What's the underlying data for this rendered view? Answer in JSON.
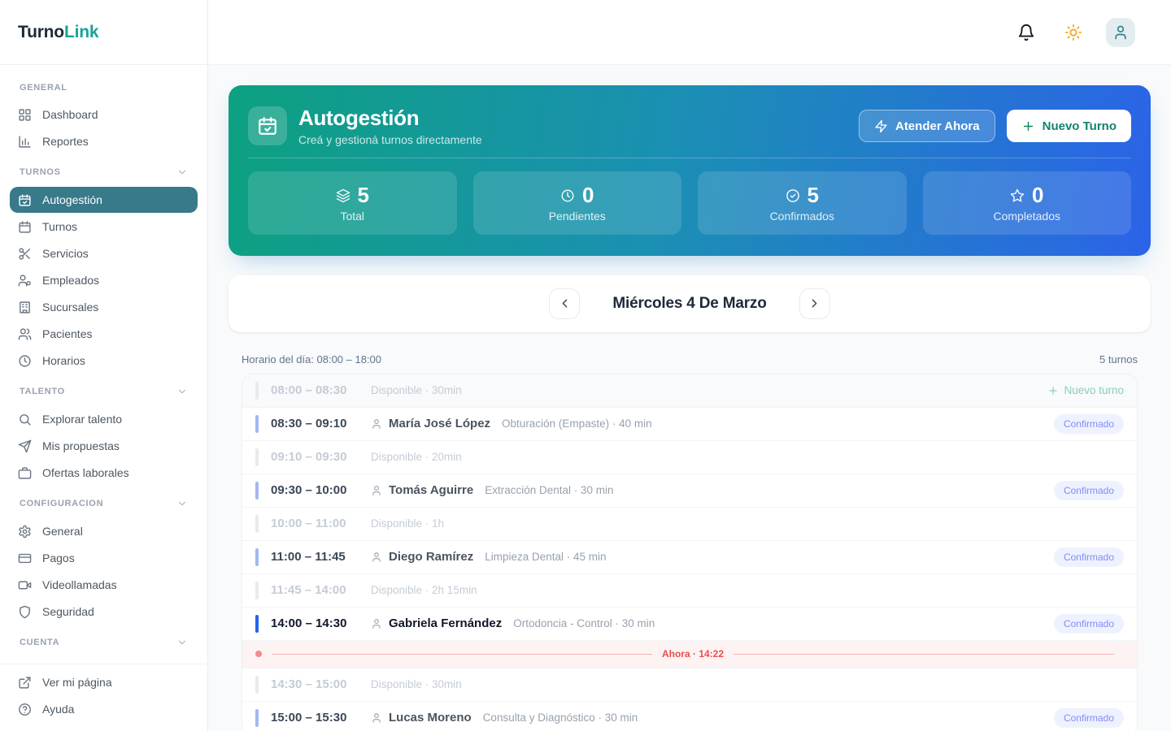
{
  "app": {
    "logo_primary": "Turno",
    "logo_accent": "Link"
  },
  "colors": {
    "accent_teal": "#38798a",
    "logo_teal": "#18a29c",
    "banner_gradient_from": "#0da180",
    "banner_gradient_to": "#2b63e8",
    "badge_bg": "#eef2ff",
    "badge_text": "#818cf8",
    "current_bar": "#2563eb",
    "booked_bar": "#a3b8f0",
    "now_red": "#e94e4e",
    "sun_amber": "#f5a524"
  },
  "topbar": {
    "icons": [
      "bell",
      "sun",
      "user"
    ]
  },
  "sidebar": {
    "sections": [
      {
        "label": "GENERAL",
        "collapsible": false,
        "items": [
          {
            "icon": "dashboard",
            "label": "Dashboard",
            "active": false
          },
          {
            "icon": "bar-chart",
            "label": "Reportes",
            "active": false
          }
        ]
      },
      {
        "label": "TURNOS",
        "collapsible": true,
        "items": [
          {
            "icon": "calendar-check",
            "label": "Autogestión",
            "active": true
          },
          {
            "icon": "calendar",
            "label": "Turnos",
            "active": false
          },
          {
            "icon": "scissors",
            "label": "Servicios",
            "active": false
          },
          {
            "icon": "user-cog",
            "label": "Empleados",
            "active": false
          },
          {
            "icon": "building",
            "label": "Sucursales",
            "active": false
          },
          {
            "icon": "users",
            "label": "Pacientes",
            "active": false
          },
          {
            "icon": "clock",
            "label": "Horarios",
            "active": false
          }
        ]
      },
      {
        "label": "TALENTO",
        "collapsible": true,
        "items": [
          {
            "icon": "search",
            "label": "Explorar talento",
            "active": false
          },
          {
            "icon": "send",
            "label": "Mis propuestas",
            "active": false
          },
          {
            "icon": "briefcase",
            "label": "Ofertas laborales",
            "active": false
          }
        ]
      },
      {
        "label": "CONFIGURACION",
        "collapsible": true,
        "items": [
          {
            "icon": "gear",
            "label": "General",
            "active": false
          },
          {
            "icon": "credit-card",
            "label": "Pagos",
            "active": false
          },
          {
            "icon": "video",
            "label": "Videollamadas",
            "active": false
          },
          {
            "icon": "shield",
            "label": "Seguridad",
            "active": false
          }
        ]
      },
      {
        "label": "CUENTA",
        "collapsible": true,
        "items": []
      }
    ],
    "footer_items": [
      {
        "icon": "external-link",
        "label": "Ver mi página"
      },
      {
        "icon": "help-circle",
        "label": "Ayuda"
      }
    ]
  },
  "banner": {
    "title": "Autogestión",
    "subtitle": "Creá y gestioná turnos directamente",
    "buttons": [
      {
        "icon": "bolt",
        "label": "Atender Ahora"
      },
      {
        "icon": "plus",
        "label": "Nuevo Turno"
      }
    ],
    "stats": [
      {
        "icon": "layers",
        "value": "5",
        "label": "Total"
      },
      {
        "icon": "clock",
        "value": "0",
        "label": "Pendientes"
      },
      {
        "icon": "check-circle",
        "value": "5",
        "label": "Confirmados"
      },
      {
        "icon": "star",
        "value": "0",
        "label": "Completados"
      }
    ]
  },
  "date_nav": {
    "title": "Miércoles 4 De Marzo"
  },
  "schedule": {
    "header_left": "Horario del día: 08:00 – 18:00",
    "header_right": "5 turnos",
    "now_label": "Ahora · 14:22",
    "add_label": "Nuevo turno",
    "rows": [
      {
        "type": "free",
        "time": "08:00 – 08:30",
        "detail": "Disponible · 30min",
        "action": true
      },
      {
        "type": "booked",
        "time": "08:30 – 09:10",
        "name": "María José López",
        "service": "Obturación (Empaste) · 40 min",
        "status": "Confirmado"
      },
      {
        "type": "free",
        "time": "09:10 – 09:30",
        "detail": "Disponible · 20min"
      },
      {
        "type": "booked",
        "time": "09:30 – 10:00",
        "name": "Tomás Aguirre",
        "service": "Extracción Dental · 30 min",
        "status": "Confirmado"
      },
      {
        "type": "free",
        "time": "10:00 – 11:00",
        "detail": "Disponible · 1h"
      },
      {
        "type": "booked",
        "time": "11:00 – 11:45",
        "name": "Diego Ramírez",
        "service": "Limpieza Dental · 45 min",
        "status": "Confirmado"
      },
      {
        "type": "free",
        "time": "11:45 – 14:00",
        "detail": "Disponible · 2h 15min"
      },
      {
        "type": "booked",
        "time": "14:00 – 14:30",
        "name": "Gabriela Fernández",
        "service": "Ortodoncia - Control · 30 min",
        "status": "Confirmado",
        "current": true
      },
      {
        "type": "now"
      },
      {
        "type": "free",
        "time": "14:30 – 15:00",
        "detail": "Disponible · 30min"
      },
      {
        "type": "booked",
        "time": "15:00 – 15:30",
        "name": "Lucas Moreno",
        "service": "Consulta y Diagnóstico · 30 min",
        "status": "Confirmado"
      }
    ]
  }
}
